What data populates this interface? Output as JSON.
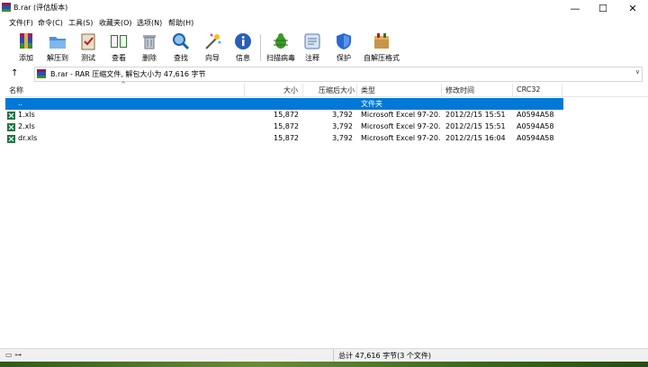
{
  "window": {
    "title": "B.rar (评估版本)",
    "controls": {
      "minimize": "—",
      "maximize": "☐",
      "close": "✕"
    }
  },
  "menu": [
    {
      "label": "文件(F)"
    },
    {
      "label": "命令(C)"
    },
    {
      "label": "工具(S)"
    },
    {
      "label": "收藏夹(O)"
    },
    {
      "label": "选项(N)"
    },
    {
      "label": "帮助(H)"
    }
  ],
  "toolbar": [
    {
      "label": "添加",
      "icon": "add-archive-icon"
    },
    {
      "label": "解压到",
      "icon": "extract-folder-icon"
    },
    {
      "label": "测试",
      "icon": "test-clipboard-icon"
    },
    {
      "label": "查看",
      "icon": "view-book-icon"
    },
    {
      "label": "删除",
      "icon": "trash-icon"
    },
    {
      "label": "查找",
      "icon": "magnifier-icon"
    },
    {
      "label": "向导",
      "icon": "wizard-wand-icon"
    },
    {
      "label": "信息",
      "icon": "info-icon"
    },
    {
      "label": "扫描病毒",
      "icon": "virus-scan-icon"
    },
    {
      "label": "注释",
      "icon": "comment-icon"
    },
    {
      "label": "保护",
      "icon": "shield-icon"
    },
    {
      "label": "自解压格式",
      "icon": "sfx-box-icon"
    }
  ],
  "address": {
    "up": "↑",
    "text": "B.rar - RAR 压缩文件, 解包大小为 47,616 字节",
    "dropdown": "∨"
  },
  "columns": {
    "name": "名称",
    "size": "大小",
    "packed": "压缩后大小",
    "type": "类型",
    "modified": "修改时间",
    "crc": "CRC32",
    "sort_arrow": "^"
  },
  "rows": [
    {
      "name": "..",
      "size": "",
      "packed": "",
      "type": "文件夹",
      "modified": "",
      "crc": "",
      "selected": true
    },
    {
      "name": "1.xls",
      "size": "15,872",
      "packed": "3,792",
      "type": "Microsoft Excel 97-20...",
      "modified": "2012/2/15 15:51",
      "crc": "A0594A58",
      "selected": false
    },
    {
      "name": "2.xls",
      "size": "15,872",
      "packed": "3,792",
      "type": "Microsoft Excel 97-20...",
      "modified": "2012/2/15 15:51",
      "crc": "A0594A58",
      "selected": false
    },
    {
      "name": "dr.xls",
      "size": "15,872",
      "packed": "3,792",
      "type": "Microsoft Excel 97-20...",
      "modified": "2012/2/15 16:04",
      "crc": "A0594A58",
      "selected": false
    }
  ],
  "status": {
    "left_icons": "▭ ⊶",
    "text": "总计 47,616 字节(3 个文件)"
  },
  "colors": {
    "selection": "#0078d7",
    "excel_green": "#1f7244"
  }
}
